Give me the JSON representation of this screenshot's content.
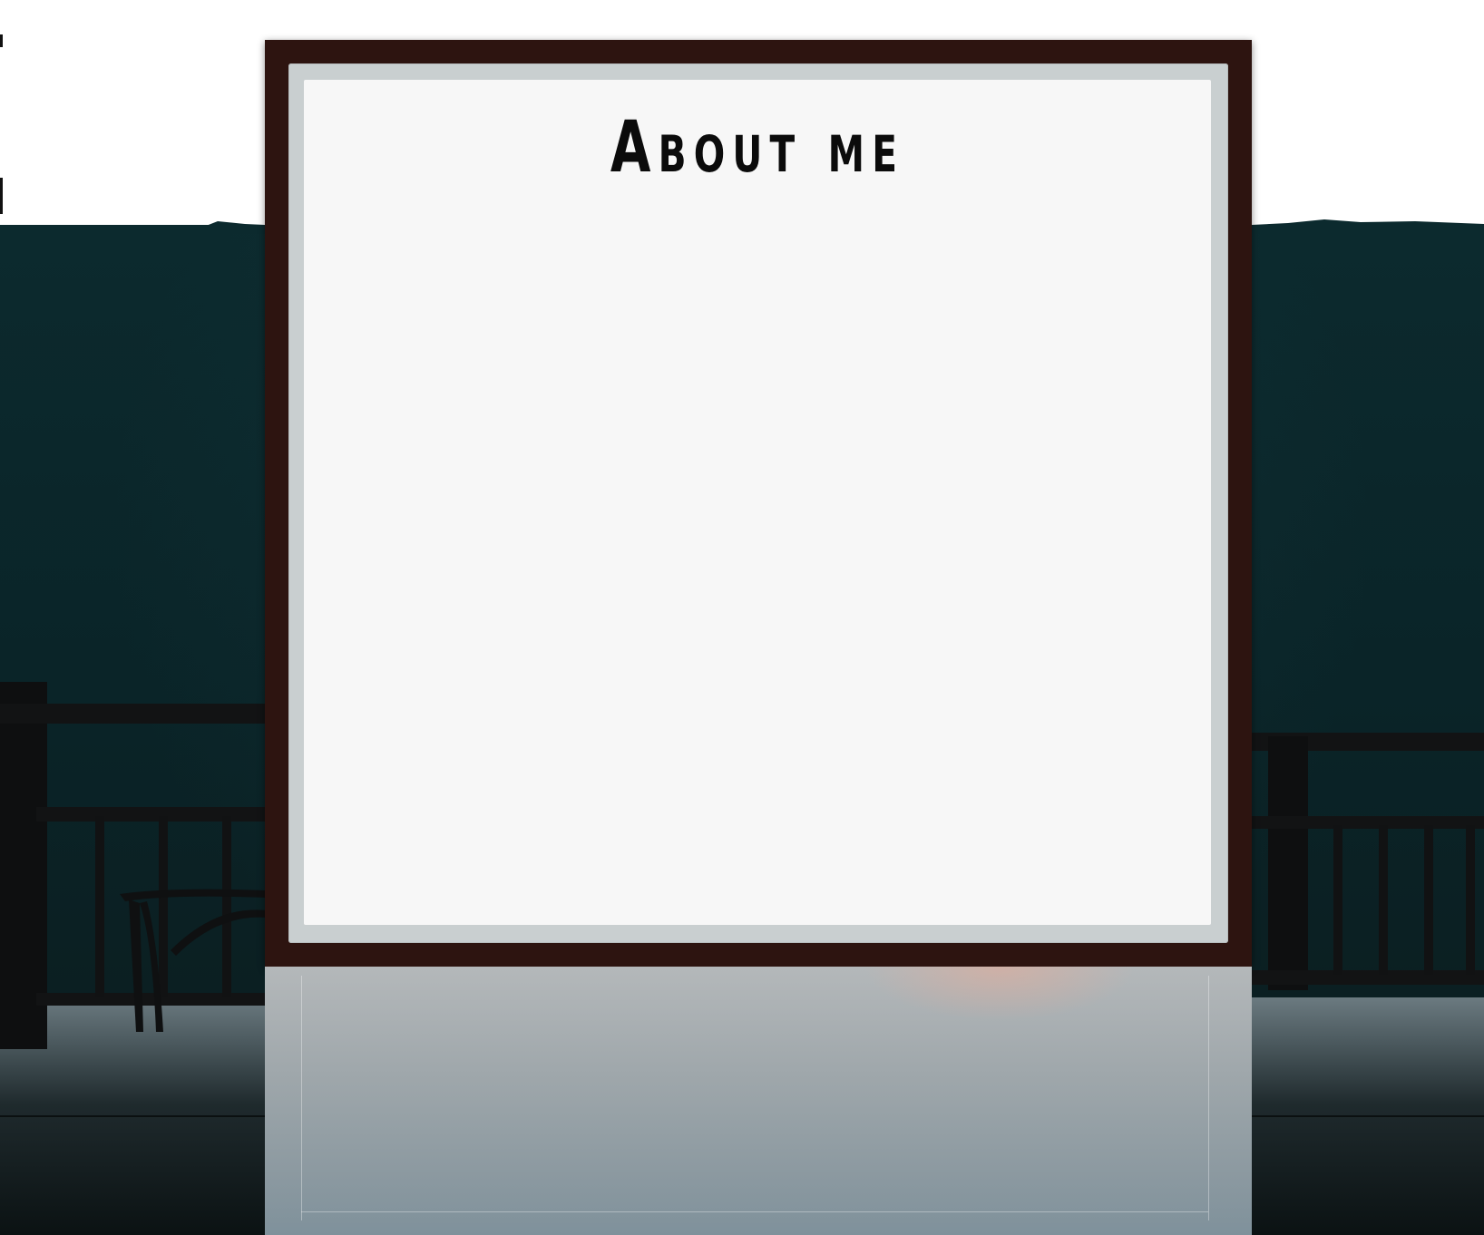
{
  "card": {
    "title": "About me"
  },
  "colors": {
    "frame": "#2d1410",
    "frame_inner": "#c9cfd0",
    "panel": "#f7f7f7",
    "backdrop": "#0c2a2e"
  }
}
